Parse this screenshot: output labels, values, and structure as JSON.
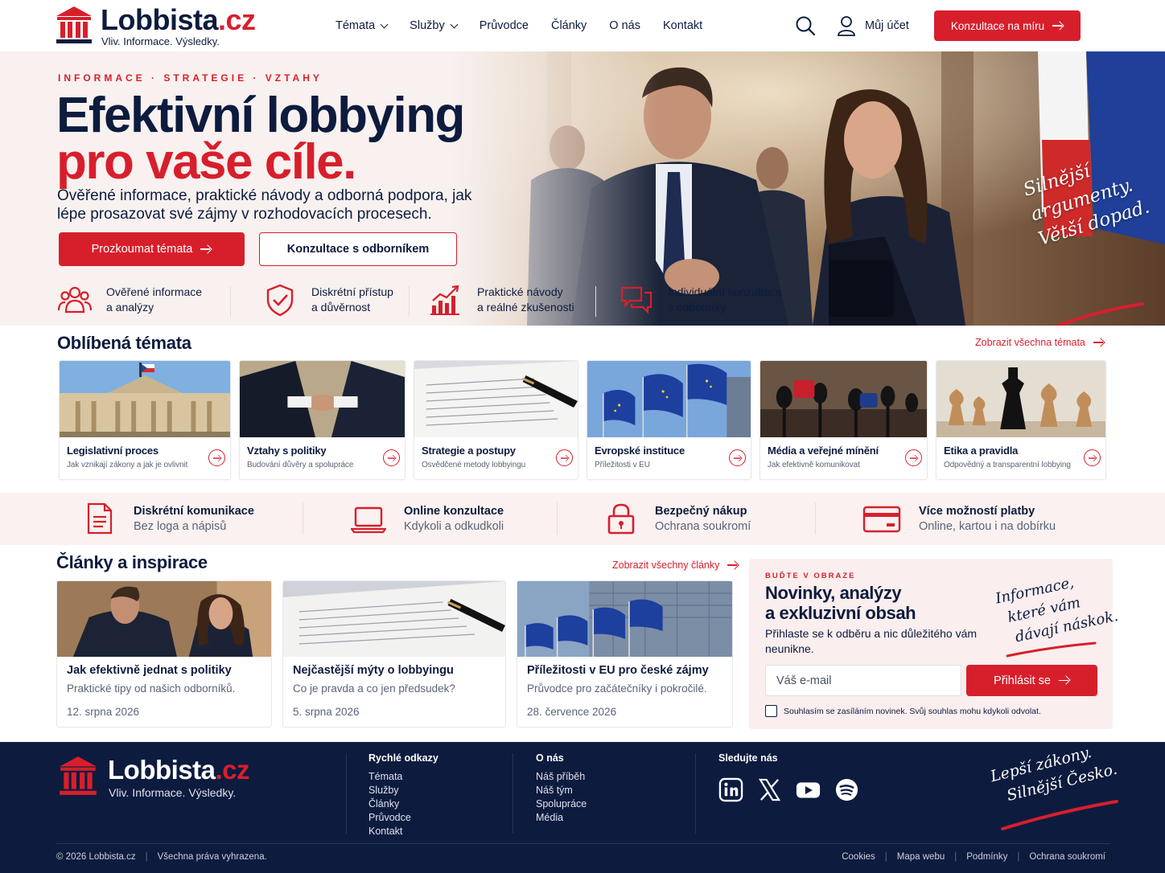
{
  "header": {
    "brand_main": "Lobbista",
    "brand_tld": ".cz",
    "tagline": "Vliv. Informace. Výsledky.",
    "nav": [
      {
        "label": "Témata",
        "dropdown": true
      },
      {
        "label": "Služby",
        "dropdown": true
      },
      {
        "label": "Průvodce",
        "dropdown": false
      },
      {
        "label": "Články",
        "dropdown": false
      },
      {
        "label": "O nás",
        "dropdown": false
      },
      {
        "label": "Kontakt",
        "dropdown": false
      }
    ],
    "account_label": "Můj účet",
    "cta_label": "Konzultace na míru"
  },
  "hero": {
    "eyebrow": "INFORMACE · STRATEGIE · VZTAHY",
    "title_line1": "Efektivní lobbying",
    "title_line2": "pro vaše cíle.",
    "subtitle": "Ověřené informace, praktické návody a odborná podpora, jak lépe prosazovat své zájmy v rozhodovacích procesech.",
    "cta_primary": "Prozkoumat témata",
    "cta_secondary": "Konzultace s odborníkem",
    "slogan_line1": "Silnější",
    "slogan_line2": "argumenty.",
    "slogan_line3": "Větší dopad.",
    "features": [
      {
        "icon": "people-icon",
        "line1": "Ověřené informace",
        "line2": "a analýzy"
      },
      {
        "icon": "shield-check-icon",
        "line1": "Diskrétní přístup",
        "line2": "a důvěrnost"
      },
      {
        "icon": "chart-icon",
        "line1": "Praktické návody",
        "line2": "a reálné zkušenosti"
      },
      {
        "icon": "chat-icon",
        "line1": "Individuální konzultace",
        "line2": "s odborníky"
      }
    ]
  },
  "topics": {
    "title": "Oblíbená témata",
    "more_label": "Zobrazit všechna témata",
    "items": [
      {
        "title": "Legislativní proces",
        "subtitle": "Jak vznikají zákony a jak je ovlivnit"
      },
      {
        "title": "Vztahy s politiky",
        "subtitle": "Budování důvěry a spolupráce"
      },
      {
        "title": "Strategie a postupy",
        "subtitle": "Osvědčené metody lobbyingu"
      },
      {
        "title": "Evropské instituce",
        "subtitle": "Příležitosti v EU"
      },
      {
        "title": "Média a veřejné mínění",
        "subtitle": "Jak efektivně komunikovat"
      },
      {
        "title": "Etika a pravidla",
        "subtitle": "Odpovědný a transparentní lobbying"
      }
    ]
  },
  "benefits": [
    {
      "icon": "document-icon",
      "title": "Diskrétní komunikace",
      "subtitle": "Bez loga a nápisů"
    },
    {
      "icon": "laptop-icon",
      "title": "Online konzultace",
      "subtitle": "Kdykoli a odkudkoli"
    },
    {
      "icon": "lock-icon",
      "title": "Bezpečný nákup",
      "subtitle": "Ochrana soukromí"
    },
    {
      "icon": "card-icon",
      "title": "Více možností platby",
      "subtitle": "Online, kartou i na dobírku"
    }
  ],
  "articles": {
    "title": "Články a inspirace",
    "more_label": "Zobrazit všechny články",
    "items": [
      {
        "title": "Jak efektivně jednat s politiky",
        "subtitle": "Praktické tipy od našich odborníků.",
        "date": "12. srpna 2026"
      },
      {
        "title": "Nejčastější mýty o lobbyingu",
        "subtitle": "Co je pravda a co jen předsudek?",
        "date": "5. srpna 2026"
      },
      {
        "title": "Příležitosti v EU pro české zájmy",
        "subtitle": "Průvodce pro začátečníky i pokročilé.",
        "date": "28. července 2026"
      }
    ]
  },
  "newsletter": {
    "eyebrow": "BUĎTE V OBRAZE",
    "title_line1": "Novinky, analýzy",
    "title_line2": "a exkluzivní obsah",
    "text": "Přihlaste se k odběru a nic důležitého vám neunikne.",
    "email_placeholder": "Váš e-mail",
    "button_label": "Přihlásit se",
    "consent": "Souhlasím se zasíláním novinek. Svůj souhlas mohu kdykoli odvolat.",
    "script_line1": "Informace,",
    "script_line2": "které vám",
    "script_line3": "dávají náskok."
  },
  "footer": {
    "brand_main": "Lobbista",
    "brand_tld": ".cz",
    "tagline": "Vliv. Informace. Výsledky.",
    "quick_title": "Rychlé odkazy",
    "quick_links": [
      "Témata",
      "Služby",
      "Články",
      "Průvodce",
      "Kontakt"
    ],
    "about_title": "O nás",
    "about_links": [
      "Náš příběh",
      "Náš tým",
      "Spolupráce",
      "Média"
    ],
    "social_title": "Sledujte nás",
    "social": [
      "linkedin-icon",
      "x-icon",
      "youtube-icon",
      "spotify-icon"
    ],
    "slogan_line1": "Lepší zákony.",
    "slogan_line2": "Silnější Česko.",
    "copyright": "© 2026 Lobbista.cz",
    "rights": "Všechna práva vyhrazena.",
    "legal_links": [
      "Cookies",
      "Mapa webu",
      "Podmínky",
      "Ochrana soukromí"
    ]
  },
  "colors": {
    "brand_red": "#d71f2c",
    "navy": "#0d1b3e",
    "hero_bg": "#f8f1ef",
    "footer_bg": "#0d1b3e"
  }
}
